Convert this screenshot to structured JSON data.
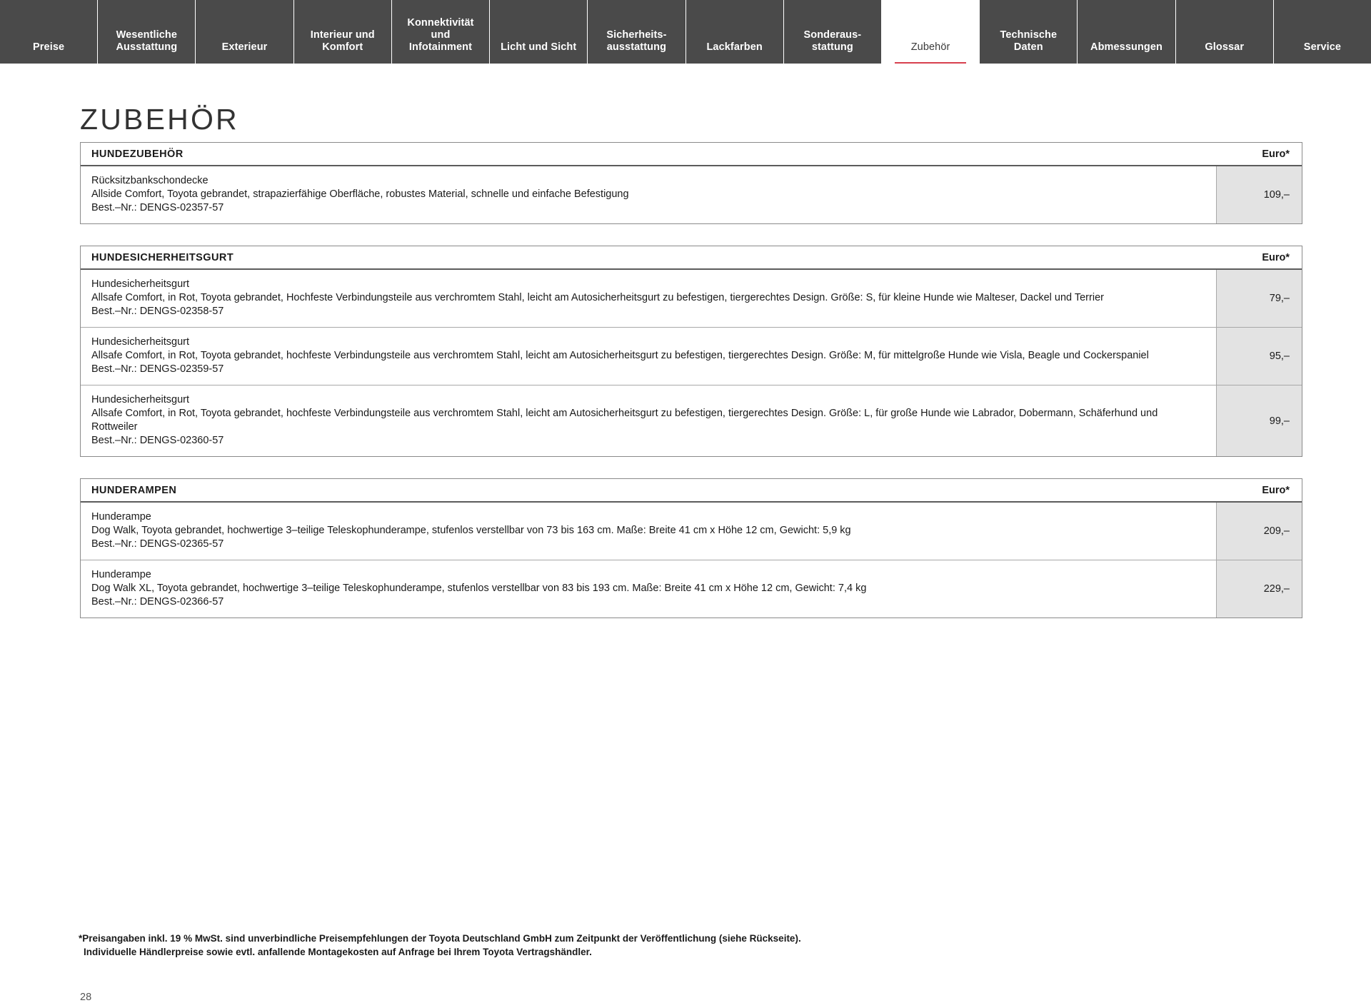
{
  "nav": {
    "tabs": [
      {
        "label": "Preise",
        "active": false
      },
      {
        "label": "Wesentliche\nAusstattung",
        "active": false
      },
      {
        "label": "Exterieur",
        "active": false
      },
      {
        "label": "Interieur und\nKomfort",
        "active": false
      },
      {
        "label": "Konnektivität\nund\nInfotainment",
        "active": false
      },
      {
        "label": "Licht und Sicht",
        "active": false
      },
      {
        "label": "Sicherheits-\nausstattung",
        "active": false
      },
      {
        "label": "Lackfarben",
        "active": false
      },
      {
        "label": "Sonderaus-\nstattung",
        "active": false
      },
      {
        "label": "Zubehör",
        "active": true
      },
      {
        "label": "Technische\nDaten",
        "active": false
      },
      {
        "label": "Abmessungen",
        "active": false
      },
      {
        "label": "Glossar",
        "active": false
      },
      {
        "label": "Service",
        "active": false
      }
    ]
  },
  "page": {
    "title": "ZUBEHÖR",
    "number": "28"
  },
  "colors": {
    "nav_background": "#4a4a4a",
    "active_underline": "#d8404e",
    "price_cell_background": "#e3e3e3"
  },
  "tables": [
    {
      "header": "HUNDEZUBEHÖR",
      "price_header": "Euro*",
      "rows": [
        {
          "name": "Rücksitzbankschondecke",
          "description": "Allside Comfort, Toyota gebrandet, strapazierfähige Oberfläche, robustes Material, schnelle und einfache Befestigung",
          "sku": "Best.–Nr.: DENGS-02357-57",
          "price": "109,–"
        }
      ]
    },
    {
      "header": "HUNDESICHERHEITSGURT",
      "price_header": "Euro*",
      "rows": [
        {
          "name": "Hundesicherheitsgurt",
          "description": "Allsafe Comfort, in Rot, Toyota gebrandet, Hochfeste Verbindungsteile aus verchromtem Stahl, leicht am Autosicherheitsgurt zu befestigen, tiergerechtes Design. Größe: S, für kleine Hunde wie Malteser, Dackel und Terrier",
          "sku": "Best.–Nr.: DENGS-02358-57",
          "price": "79,–"
        },
        {
          "name": "Hundesicherheitsgurt",
          "description": "Allsafe Comfort, in Rot, Toyota gebrandet, hochfeste Verbindungsteile aus verchromtem Stahl, leicht am Autosicherheitsgurt zu befestigen, tiergerechtes Design. Größe: M, für mittelgroße Hunde wie Visla, Beagle und Cockerspaniel",
          "sku": "Best.–Nr.: DENGS-02359-57",
          "price": "95,–"
        },
        {
          "name": "Hundesicherheitsgurt",
          "description": "Allsafe Comfort, in Rot, Toyota gebrandet, hochfeste Verbindungsteile aus verchromtem Stahl, leicht am Autosicherheitsgurt zu befestigen, tiergerechtes Design. Größe: L, für große Hunde wie Labrador, Dobermann, Schäferhund und Rottweiler",
          "sku": "Best.–Nr.: DENGS-02360-57",
          "price": "99,–"
        }
      ]
    },
    {
      "header": "HUNDERAMPEN",
      "price_header": "Euro*",
      "rows": [
        {
          "name": "Hunderampe",
          "description": "Dog Walk, Toyota gebrandet, hochwertige 3–teilige Teleskophunderampe, stufenlos verstellbar von 73 bis 163 cm. Maße: Breite 41 cm x Höhe 12 cm, Gewicht: 5,9 kg",
          "sku": "Best.–Nr.: DENGS-02365-57",
          "price": "209,–"
        },
        {
          "name": "Hunderampe",
          "description": "Dog Walk XL, Toyota gebrandet, hochwertige 3–teilige Teleskophunderampe, stufenlos verstellbar von 83 bis 193 cm. Maße: Breite 41 cm x Höhe 12 cm, Gewicht: 7,4 kg",
          "sku": "Best.–Nr.: DENGS-02366-57",
          "price": "229,–"
        }
      ]
    }
  ],
  "footnote": {
    "line1": "*Preisangaben inkl. 19 % MwSt. sind unverbindliche Preisempfehlungen der Toyota Deutschland GmbH zum Zeitpunkt der Veröffentlichung (siehe Rückseite).",
    "line2": "Individuelle Händlerpreise sowie evtl. anfallende Montagekosten auf Anfrage bei Ihrem Toyota Vertragshändler."
  }
}
